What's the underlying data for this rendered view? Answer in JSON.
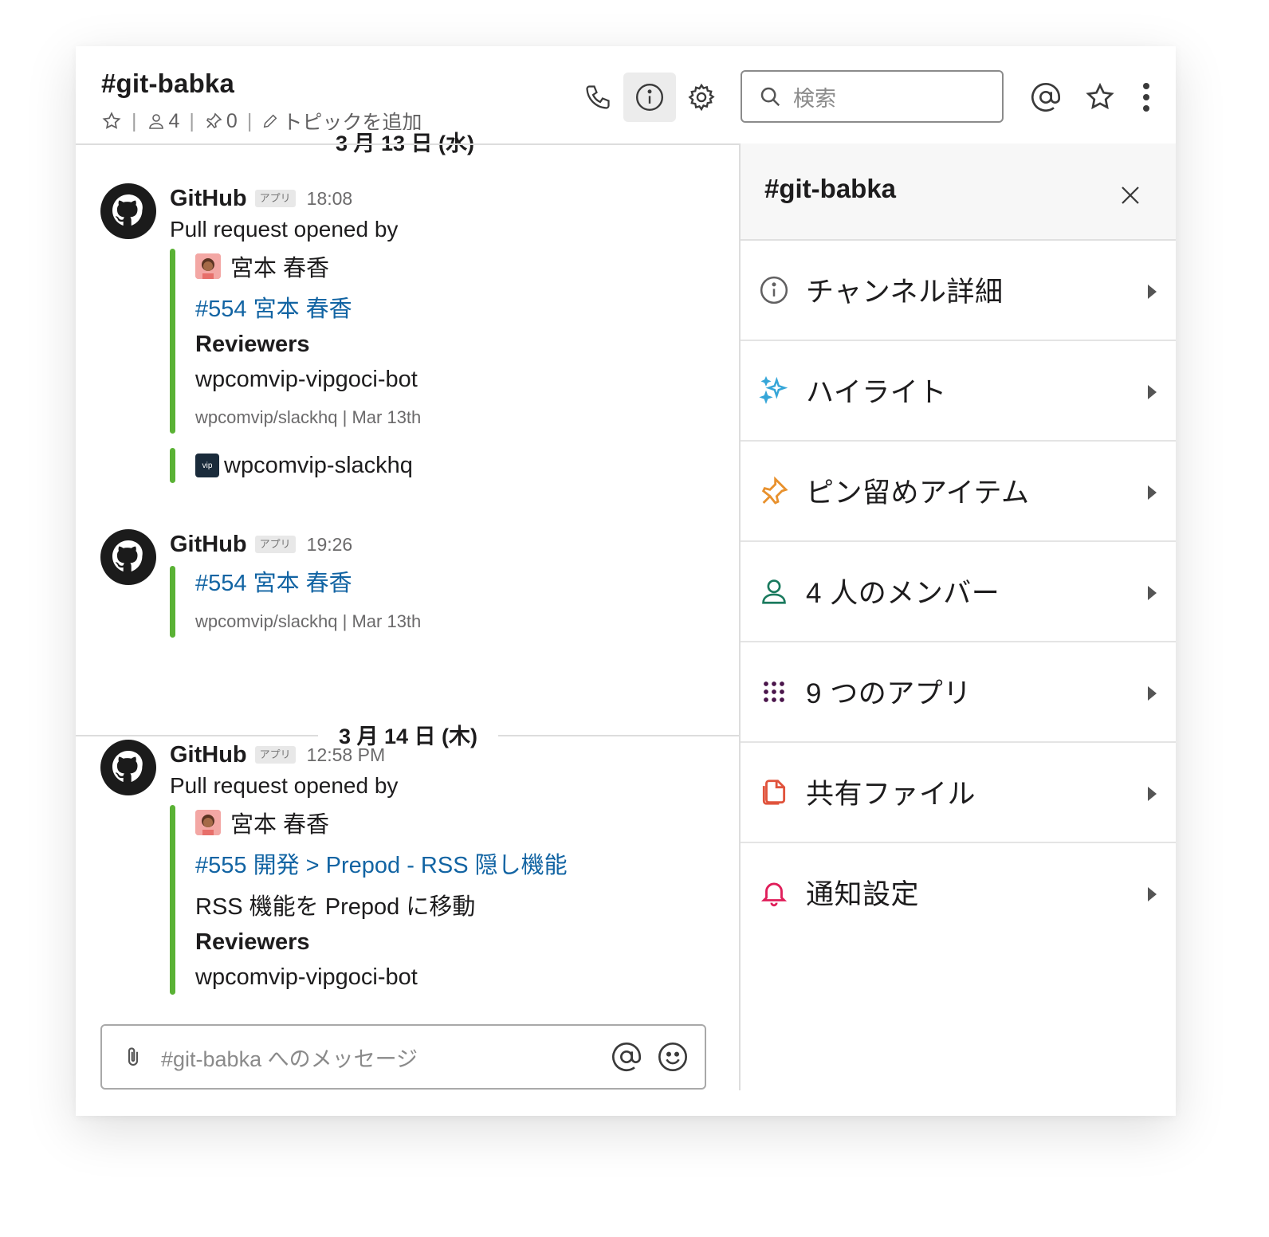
{
  "header": {
    "title": "#git-babka",
    "members_count": "4",
    "pins_count": "0",
    "topic_placeholder": "トピックを追加",
    "search_placeholder": "検索"
  },
  "messages": {
    "dates": [
      "3 月 13 日 (水)",
      "3 月 14 日 (木)"
    ],
    "items": [
      {
        "sender": "GitHub",
        "badge": "アプリ",
        "time": "18:08",
        "text": "Pull request opened by",
        "author": "宮本 春香",
        "pr_link": "#554 宮本 春香",
        "reviewers_label": "Reviewers",
        "reviewer": "wpcomvip-vipgoci-bot",
        "footer": "wpcomvip/slackhq | Mar 13th",
        "org_logo_text": "vip",
        "org": "wpcomvip-slackhq"
      },
      {
        "sender": "GitHub",
        "badge": "アプリ",
        "time": "19:26",
        "pr_link": "#554 宮本 春香",
        "footer": "wpcomvip/slackhq | Mar 13th"
      },
      {
        "sender": "GitHub",
        "badge": "アプリ",
        "time": "12:58 PM",
        "text": "Pull request opened by",
        "author": "宮本 春香",
        "pr_link": "#555 開発 > Prepod - RSS 隠し機能",
        "description": "RSS 機能を Prepod に移動",
        "reviewers_label": "Reviewers",
        "reviewer": "wpcomvip-vipgoci-bot"
      }
    ]
  },
  "composer": {
    "placeholder": "#git-babka へのメッセージ"
  },
  "panel": {
    "title": "#git-babka",
    "items": [
      {
        "label": "チャンネル詳細",
        "icon": "info-icon",
        "color": "#616061"
      },
      {
        "label": "ハイライト",
        "icon": "sparkles-icon",
        "color": "#36a6d8"
      },
      {
        "label": "ピン留めアイテム",
        "icon": "pin-icon",
        "color": "#ecb22e"
      },
      {
        "label": "4 人のメンバー",
        "icon": "person-icon",
        "color": "#1a7a5e"
      },
      {
        "label": "9 つのアプリ",
        "icon": "apps-grid-icon",
        "color": "#4a154b"
      },
      {
        "label": "共有ファイル",
        "icon": "files-icon",
        "color": "#e0533c"
      },
      {
        "label": "通知設定",
        "icon": "bell-icon",
        "color": "#e01e5a"
      }
    ]
  }
}
